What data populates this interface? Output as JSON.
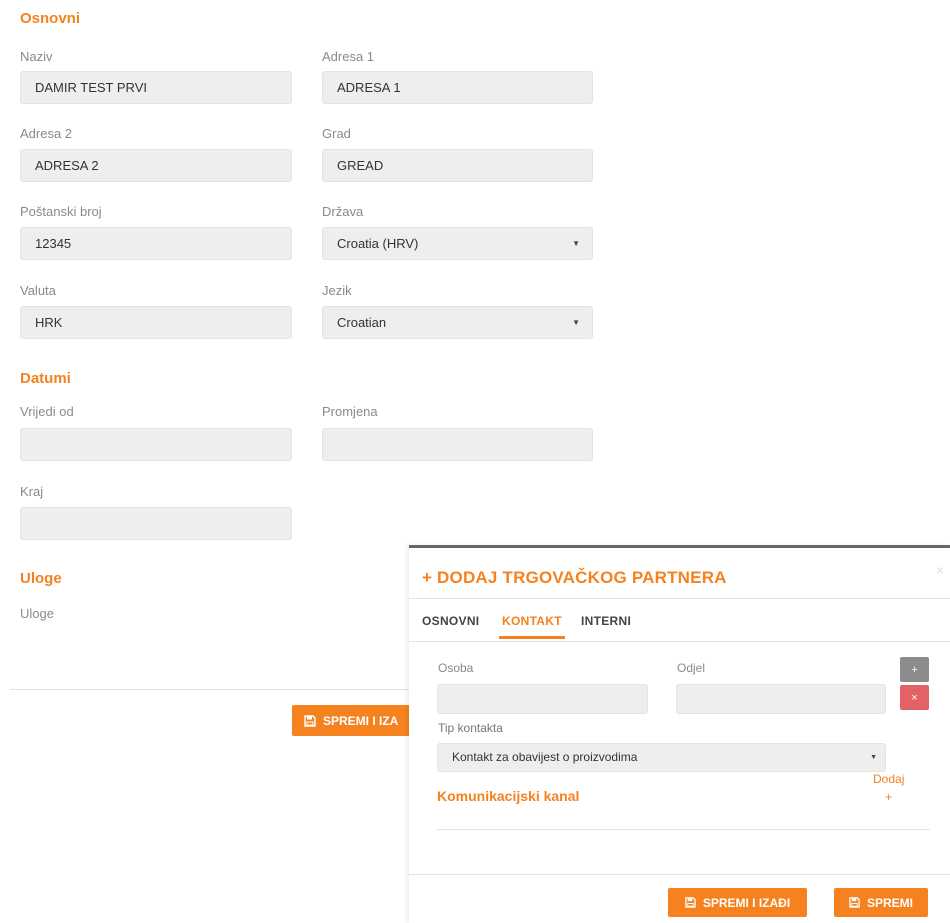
{
  "sections": {
    "osnovni": "Osnovni",
    "datumi": "Datumi",
    "uloge": "Uloge"
  },
  "form": {
    "naziv": {
      "label": "Naziv",
      "value": "DAMIR TEST PRVI"
    },
    "adresa1": {
      "label": "Adresa 1",
      "value": "ADRESA 1"
    },
    "adresa2": {
      "label": "Adresa 2",
      "value": "ADRESA 2"
    },
    "grad": {
      "label": "Grad",
      "value": "GREAD"
    },
    "postanski_broj": {
      "label": "Poštanski broj",
      "value": "12345"
    },
    "drzava": {
      "label": "Država",
      "value": "Croatia (HRV)"
    },
    "valuta": {
      "label": "Valuta",
      "value": "HRK"
    },
    "jezik": {
      "label": "Jezik",
      "value": "Croatian"
    },
    "vrijedi_od": {
      "label": "Vrijedi od",
      "value": ""
    },
    "promjena": {
      "label": "Promjena",
      "value": ""
    },
    "kraj": {
      "label": "Kraj",
      "value": ""
    },
    "uloge_label": "Uloge"
  },
  "background_footer": {
    "save_exit_label": "SPREMI I IZA"
  },
  "modal": {
    "title": "+ DODAJ TRGOVAČKOG PARTNERA",
    "close": "×",
    "tabs": [
      "OSNOVNI",
      "KONTAKT",
      "INTERNI"
    ],
    "active_tab": "KONTAKT",
    "osoba": {
      "label": "Osoba",
      "value": ""
    },
    "odjel": {
      "label": "Odjel",
      "value": ""
    },
    "add_symbol": "+",
    "remove_symbol": "×",
    "tip_kontakta": {
      "label": "Tip kontakta",
      "value": "Kontakt za obavijest o proizvodima"
    },
    "komunikacijski_kanal": "Komunikacijski kanal",
    "dodaj_label": "Dodaj",
    "dodaj_plus": "+",
    "save_exit_label": "SPREMI I IZAĐI",
    "save_label": "SPREMI"
  },
  "colors": {
    "accent": "#f5821f",
    "danger": "#e36267",
    "neutral_btn": "#8c8c8c"
  }
}
